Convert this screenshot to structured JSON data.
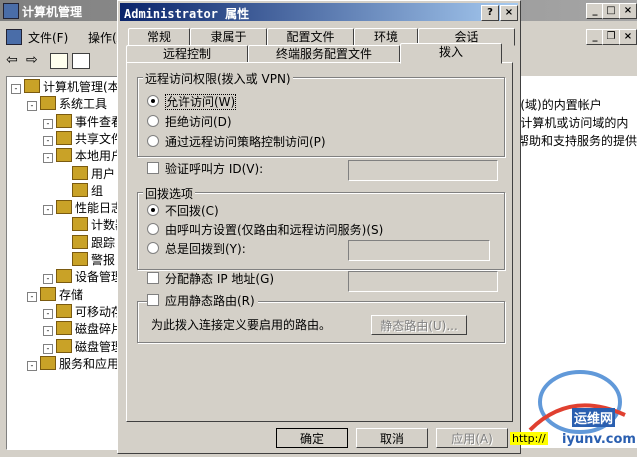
{
  "mmc": {
    "title": "计算机管理",
    "menu": [
      "文件(F)",
      "操作(A)"
    ],
    "tree": [
      {
        "label": "计算机管理(本地",
        "indent": 0
      },
      {
        "label": "系统工具",
        "indent": 1
      },
      {
        "label": "事件查看",
        "indent": 2
      },
      {
        "label": "共享文件",
        "indent": 2
      },
      {
        "label": "本地用户",
        "indent": 2
      },
      {
        "label": "用户",
        "indent": 3
      },
      {
        "label": "组",
        "indent": 3
      },
      {
        "label": "性能日志",
        "indent": 2
      },
      {
        "label": "计数器",
        "indent": 3
      },
      {
        "label": "跟踪日",
        "indent": 3
      },
      {
        "label": "警报",
        "indent": 3
      },
      {
        "label": "设备管理",
        "indent": 2
      },
      {
        "label": "存储",
        "indent": 1
      },
      {
        "label": "可移动存",
        "indent": 2
      },
      {
        "label": "磁盘碎片",
        "indent": 2
      },
      {
        "label": "磁盘管理",
        "indent": 2
      },
      {
        "label": "服务和应用程",
        "indent": 1
      }
    ],
    "right_pane": [
      "l(域)的内置帐户",
      "i计算机或访问域的内",
      "帮助和支持服务的提供"
    ]
  },
  "dialog": {
    "title": "Administrator 属性",
    "help_btn": "?",
    "close_btn": "×",
    "tabs_row1": [
      "常规",
      "隶属于",
      "配置文件",
      "环境",
      "会话"
    ],
    "tabs_row2": [
      "远程控制",
      "终端服务配置文件",
      "拨入"
    ],
    "active_tab": "拨入",
    "remote_access": {
      "group_label": "远程访问权限(拨入或 VPN)",
      "options": [
        "允许访问(W)",
        "拒绝访问(D)",
        "通过远程访问策略控制访问(P)"
      ],
      "selected": 0
    },
    "verify_caller_id": {
      "label": "验证呼叫方 ID(V):",
      "checked": false
    },
    "callback": {
      "group_label": "回拨选项",
      "options": [
        "不回拨(C)",
        "由呼叫方设置(仅路由和远程访问服务)(S)",
        "总是回拨到(Y):"
      ],
      "selected": 0
    },
    "static_ip": {
      "label": "分配静态 IP 地址(G)",
      "checked": false
    },
    "static_routes": {
      "label": "应用静态路由(R)",
      "checked": false,
      "description": "为此拨入连接定义要启用的路由。",
      "button": "静态路由(U)..."
    },
    "buttons": {
      "ok": "确定",
      "cancel": "取消",
      "apply": "应用(A)"
    }
  },
  "watermark": {
    "brand": "运维网",
    "url": "iyunv.com",
    "prefix": "http://"
  },
  "colors": {
    "title_active": "#0a246a",
    "title_inactive": "#808080",
    "face": "#d4d0c8"
  }
}
